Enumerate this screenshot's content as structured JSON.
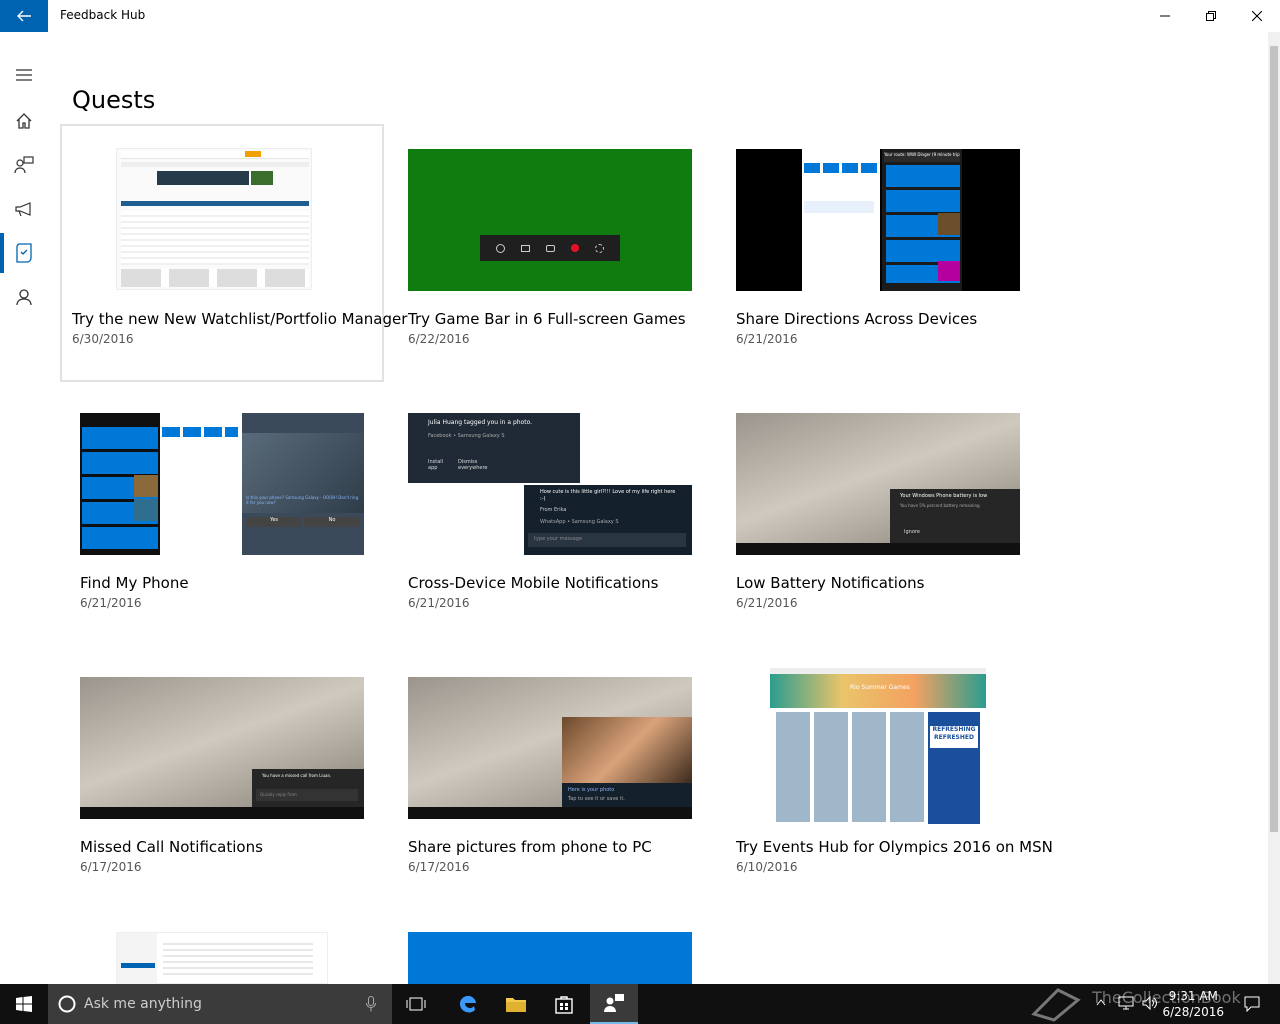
{
  "window": {
    "title": "Feedback Hub"
  },
  "page": {
    "heading": "Quests"
  },
  "cards": [
    {
      "title": "Try the new New Watchlist/Portfolio Manager",
      "date": "6/30/2016"
    },
    {
      "title": "Try Game Bar in 6 Full-screen Games",
      "date": "6/22/2016"
    },
    {
      "title": "Share Directions Across Devices",
      "date": "6/21/2016"
    },
    {
      "title": "Find My Phone",
      "date": "6/21/2016"
    },
    {
      "title": "Cross-Device Mobile Notifications",
      "date": "6/21/2016"
    },
    {
      "title": "Low Battery Notifications",
      "date": "6/21/2016"
    },
    {
      "title": "Missed Call Notifications",
      "date": "6/17/2016"
    },
    {
      "title": "Share pictures from phone to PC",
      "date": "6/17/2016"
    },
    {
      "title": "Try Events Hub for Olympics 2016 on MSN",
      "date": "6/10/2016"
    }
  ],
  "thumbs": {
    "cortana_banner": "Your route: WWI Dinger (9 minute trip)",
    "toast_tag": "Julia Huang tagged you in a photo.",
    "toast_tag_source": "Facebook • Samsung Galaxy S",
    "toast_install": "Install app",
    "toast_dismiss": "Dismiss everywhere",
    "toast_msg": "How cute is this little girl?!!! Love of my life right here :-)",
    "toast_from": "From Erika",
    "toast_msg_source": "WhatsApp • Samsung Galaxy S",
    "toast_reply_placeholder": "type your message",
    "battery_title": "Your Windows Phone battery is low",
    "battery_body": "You have 5% percent battery remaining.",
    "battery_ignore": "Ignore",
    "missed_call": "You have a missed call from Liuan.",
    "missed_call_reply": "Quickly reply from",
    "photo_caption": "Here is your photo",
    "photo_sub": "Tap to see it or save it.",
    "olympics_banner": "Rio Summer Games",
    "olympics_ad": "REFRESHING REFRESHED",
    "phone_prompt": "Is this your phone? Samsung Galaxy - OOOH! Don't ring it for you now?",
    "phone_yes": "Yes",
    "phone_no": "No"
  },
  "taskbar": {
    "search_placeholder": "Ask me anything",
    "time": "9:31 AM",
    "date": "6/28/2016",
    "watermark": "TheCollectionBook"
  },
  "colors": {
    "accent": "#0063b1",
    "gamebar_green": "#107c10",
    "tile_blue": "#0078d7"
  }
}
